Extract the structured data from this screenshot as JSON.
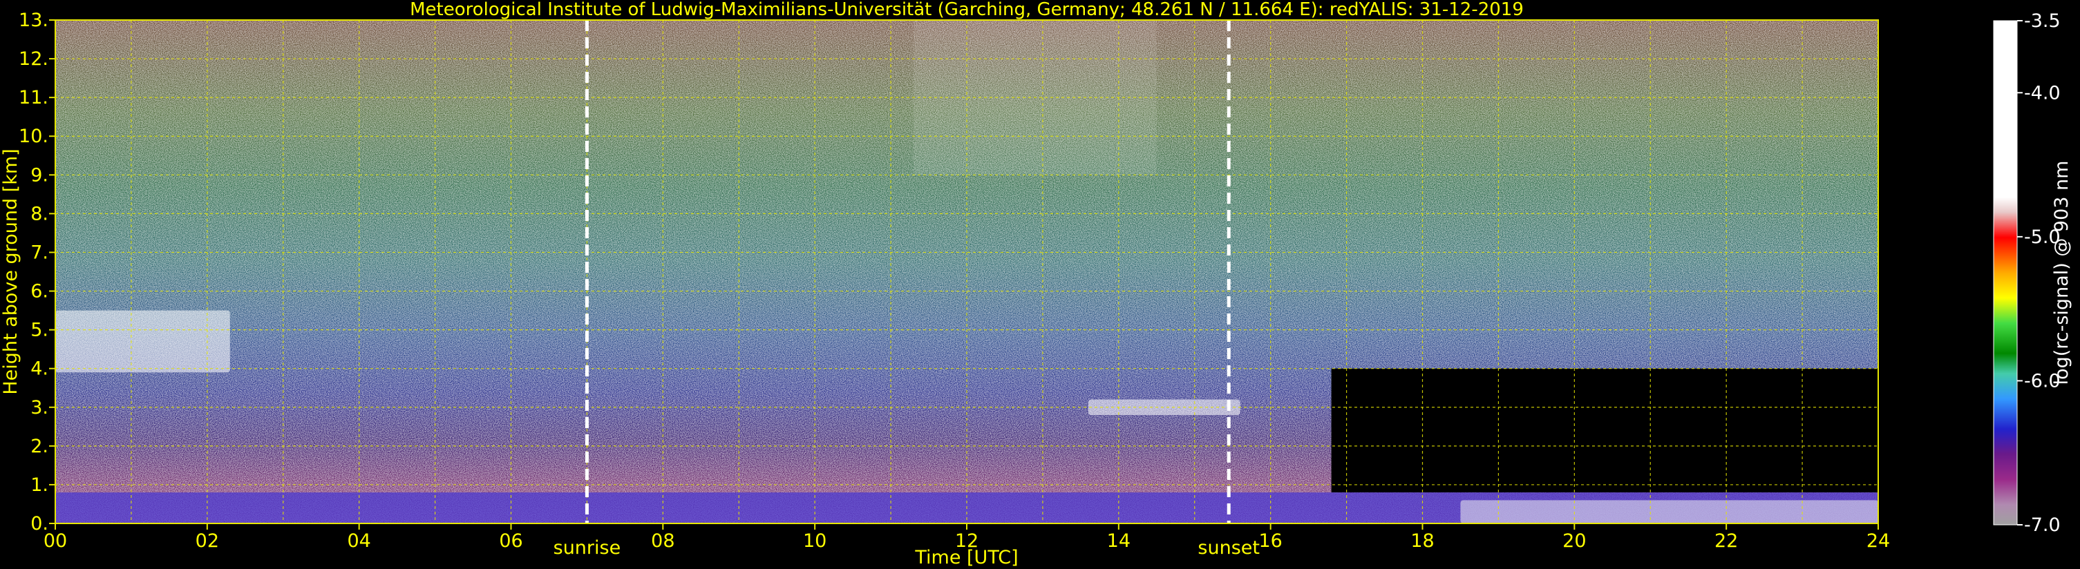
{
  "chart_data": {
    "type": "heatmap",
    "title": "Meteorological Institute of Ludwig-Maximilians-Universität (Garching, Germany; 48.261 N / 11.664 E):    redYALIS: 31-12-2019",
    "xlabel": "Time [UTC]",
    "ylabel": "Height above ground [km]",
    "xlim": [
      0,
      24
    ],
    "ylim": [
      0,
      13
    ],
    "x_ticks": [
      "00",
      "02",
      "04",
      "06",
      "08",
      "10",
      "12",
      "14",
      "16",
      "18",
      "20",
      "22",
      "24"
    ],
    "x_tick_values": [
      0,
      2,
      4,
      6,
      8,
      10,
      12,
      14,
      16,
      18,
      20,
      22,
      24
    ],
    "y_ticks": [
      "0.",
      "1.",
      "2.",
      "3.",
      "4.",
      "5.",
      "6.",
      "7.",
      "8.",
      "9.",
      "10.",
      "11.",
      "12.",
      "13."
    ],
    "y_tick_values": [
      0,
      1,
      2,
      3,
      4,
      5,
      6,
      7,
      8,
      9,
      10,
      11,
      12,
      13
    ],
    "x_grid_values": [
      1,
      2,
      3,
      4,
      5,
      6,
      7,
      8,
      9,
      10,
      11,
      12,
      13,
      14,
      15,
      16,
      17,
      18,
      19,
      20,
      21,
      22,
      23
    ],
    "grid": true,
    "markers": [
      {
        "label": "sunrise",
        "x": 7.0
      },
      {
        "label": "sunset",
        "x": 15.45
      }
    ],
    "colorbar": {
      "label": "log(rc-signal) @ 903 nm",
      "range": [
        -7.0,
        -3.5
      ],
      "ticks": [
        "-3.5",
        "-4.0",
        "-5.0",
        "-6.0",
        "-7.0"
      ],
      "tick_values": [
        -3.5,
        -4.0,
        -5.0,
        -6.0,
        -7.0
      ]
    },
    "features": [
      {
        "layer": "cloud",
        "x_range": [
          0,
          2.3
        ],
        "height_range": [
          3.9,
          5.5
        ]
      },
      {
        "layer": "cloud",
        "x_range": [
          13.6,
          15.6
        ],
        "height_range": [
          2.8,
          3.2
        ]
      },
      {
        "layer": "aerosol",
        "x_range": [
          0,
          24
        ],
        "height_range": [
          0,
          0.8
        ]
      },
      {
        "layer": "low cloud",
        "x_range": [
          18.5,
          24
        ],
        "height_range": [
          0,
          0.6
        ]
      }
    ]
  },
  "colors": {
    "text": "#ffff00",
    "grid": "#e6e600",
    "marker": "#ffffff",
    "background": "#000000"
  }
}
